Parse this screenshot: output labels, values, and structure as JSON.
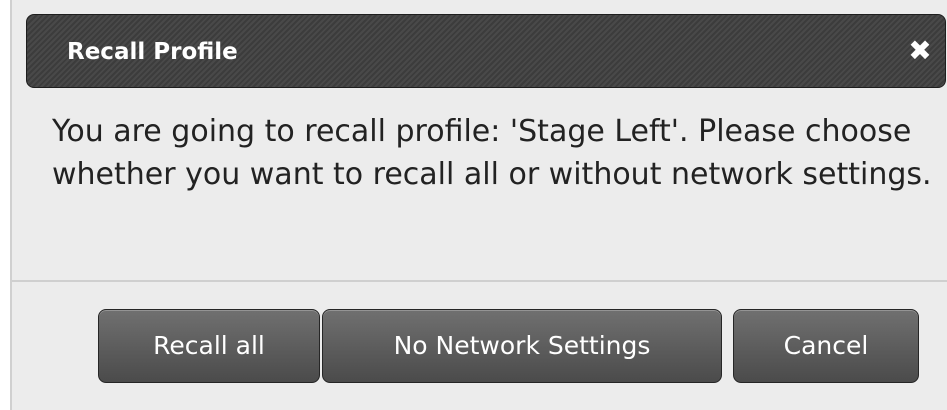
{
  "dialog": {
    "title": "Recall Profile",
    "close_icon": "close-icon",
    "close_glyph": "✖",
    "message": "You are going to recall profile: 'Stage Left'. Please choose whether you want to recall all or without network settings.",
    "buttons": {
      "recall_all": "Recall all",
      "no_network": "No Network Settings",
      "cancel": "Cancel"
    }
  },
  "colors": {
    "titlebar": "#3f3f3f",
    "body_bg": "#ececec",
    "button": "#5a5a5a",
    "text": "#222222"
  }
}
